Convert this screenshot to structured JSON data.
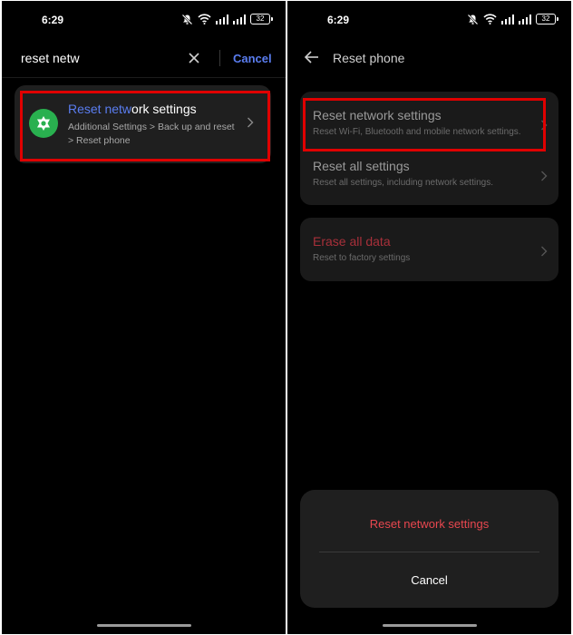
{
  "left": {
    "status": {
      "time": "6:29",
      "battery": "32"
    },
    "search": {
      "query": "reset netw",
      "cancel_label": "Cancel"
    },
    "result": {
      "title_highlight": "Reset netw",
      "title_rest": "ork settings",
      "subtitle": "Additional Settings > Back up and reset > Reset phone",
      "icon": "gear-icon"
    }
  },
  "right": {
    "status": {
      "time": "6:29",
      "battery": "32"
    },
    "header": {
      "title": "Reset phone"
    },
    "options": [
      {
        "title": "Reset network settings",
        "subtitle": "Reset Wi-Fi, Bluetooth and mobile network settings."
      },
      {
        "title": "Reset all settings",
        "subtitle": "Reset all settings, including network settings."
      }
    ],
    "danger_option": {
      "title": "Erase all data",
      "subtitle": "Reset to factory settings"
    },
    "sheet": {
      "confirm_label": "Reset network settings",
      "cancel_label": "Cancel"
    }
  },
  "colors": {
    "accent": "#5a7df0",
    "danger": "#e8474f",
    "highlight_box": "#e00000",
    "app_icon": "#29b04f"
  }
}
